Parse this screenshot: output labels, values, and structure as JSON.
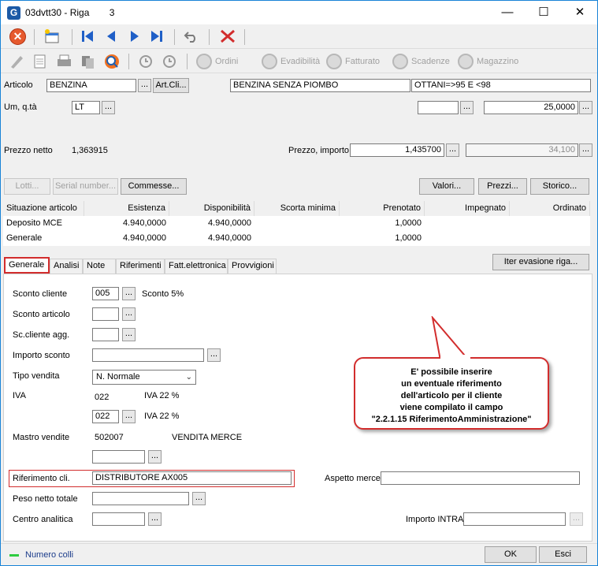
{
  "window": {
    "app_icon": "G",
    "title": "03dvtt30 - Riga",
    "record": "3",
    "minimize": "—",
    "maximize": "☐",
    "close": "✕"
  },
  "toolbar2": {
    "ordini": "Ordini",
    "evadibilita": "Evadibilità",
    "fatturato": "Fatturato",
    "scadenze": "Scadenze",
    "magazzino": "Magazzino"
  },
  "articolo": {
    "label": "Articolo",
    "code": "BENZINA",
    "dots": "...",
    "artcli": "Art.Cli...",
    "descr1": "BENZINA SENZA PIOMBO",
    "descr2": "OTTANI=>95 E <98"
  },
  "um": {
    "label": "Um, q.tà",
    "value": "LT",
    "qty_left": "",
    "qty": "25,0000"
  },
  "prezzo": {
    "netto_label": "Prezzo netto",
    "netto_value": "1,363915",
    "importo_label": "Prezzo, importo",
    "prezzo_value": "1,435700",
    "importo_value": "34,100"
  },
  "buttons_row": {
    "lotti": "Lotti...",
    "serial": "Serial number...",
    "commesse": "Commesse...",
    "valori": "Valori...",
    "prezzi": "Prezzi...",
    "storico": "Storico..."
  },
  "grid": {
    "headers": [
      "Situazione articolo",
      "Esistenza",
      "Disponibilità",
      "Scorta minima",
      "Prenotato",
      "Impegnato",
      "Ordinato"
    ],
    "rows": [
      [
        "Deposito MCE",
        "4.940,0000",
        "4.940,0000",
        "",
        "1,0000",
        "",
        ""
      ],
      [
        "Generale",
        "4.940,0000",
        "4.940,0000",
        "",
        "1,0000",
        "",
        ""
      ]
    ]
  },
  "tabs": [
    "Generale",
    "Analisi",
    "Note",
    "Riferimenti",
    "Fatt.elettronica",
    "Provvigioni"
  ],
  "iter_button": "Iter evasione riga...",
  "form": {
    "sconto_cliente_label": "Sconto cliente",
    "sconto_cliente_value": "005",
    "sconto_cliente_descr": "Sconto 5%",
    "sconto_articolo_label": "Sconto articolo",
    "sc_cliente_agg_label": "Sc.cliente agg.",
    "importo_sconto_label": "Importo sconto",
    "tipo_vendita_label": "Tipo vendita",
    "tipo_vendita_value": "N. Normale",
    "iva_label": "IVA",
    "iva_code": "022",
    "iva_descr": "IVA 22 %",
    "iva_code2": "022",
    "iva_descr2": "IVA 22 %",
    "mastro_label": "Mastro vendite",
    "mastro_code": "502007",
    "mastro_descr": "VENDITA MERCE",
    "riferimento_label": "Riferimento cli.",
    "riferimento_value": "DISTRIBUTORE AX005",
    "aspetto_label": "Aspetto merce",
    "peso_label": "Peso netto totale",
    "centro_label": "Centro analitica",
    "intra_label": "Importo INTRA"
  },
  "callout": {
    "lines": [
      "E' possibile inserire",
      "un eventuale riferimento",
      "dell'articolo per il cliente",
      "viene compilato il campo",
      "\"2.2.1.15 RiferimentoAmministrazione\""
    ]
  },
  "status": {
    "numero_colli": "Numero colli",
    "ok": "OK",
    "esci": "Esci"
  }
}
